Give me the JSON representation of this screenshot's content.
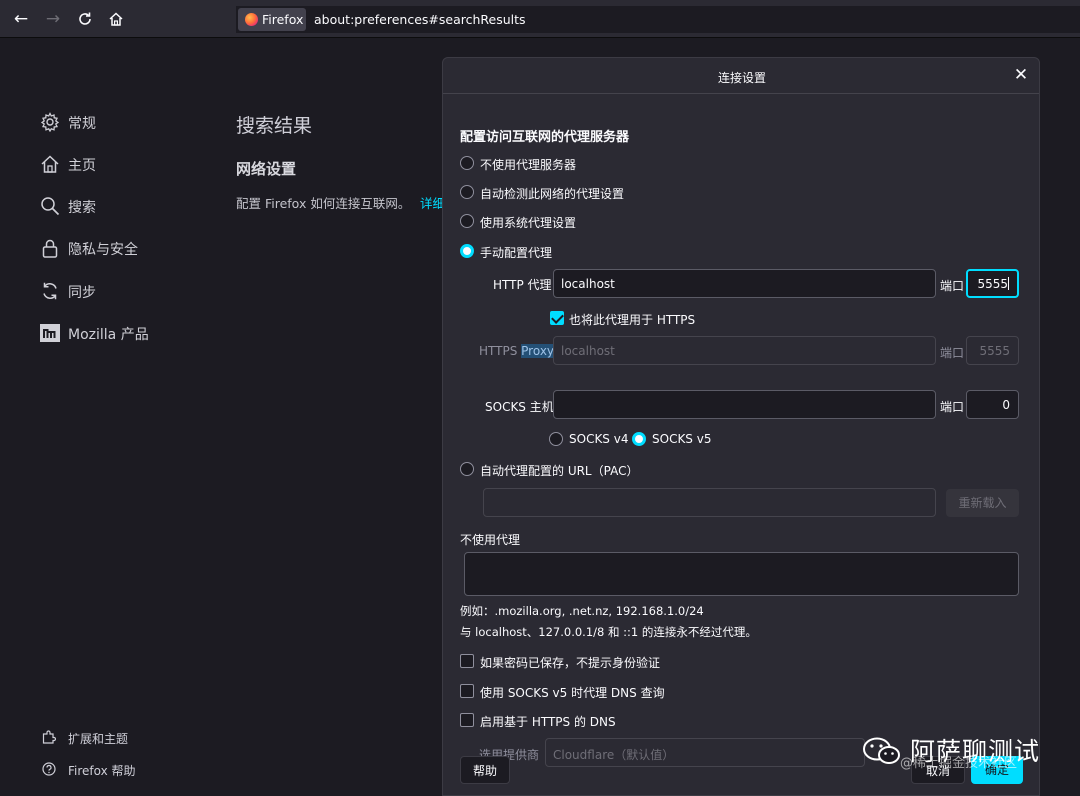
{
  "browser": {
    "identity_label": "Firefox",
    "url": "about:preferences#searchResults"
  },
  "sidebar": {
    "items": [
      {
        "label": "常规",
        "icon": "gear-icon"
      },
      {
        "label": "主页",
        "icon": "home-icon"
      },
      {
        "label": "搜索",
        "icon": "search-icon"
      },
      {
        "label": "隐私与安全",
        "icon": "lock-icon"
      },
      {
        "label": "同步",
        "icon": "sync-icon"
      },
      {
        "label": "Mozilla 产品",
        "icon": "mozilla-icon"
      }
    ],
    "bottom": [
      {
        "label": "扩展和主题",
        "icon": "puzzle-icon"
      },
      {
        "label": "Firefox 帮助",
        "icon": "help-icon"
      }
    ]
  },
  "content": {
    "title": "搜索结果",
    "section": "网络设置",
    "description": "配置 Firefox 如何连接互联网。",
    "link_partial": "详细"
  },
  "dialog": {
    "title": "连接设置",
    "heading": "配置访问互联网的代理服务器",
    "options": {
      "no_proxy": "不使用代理服务器",
      "auto_detect": "自动检测此网络的代理设置",
      "system": "使用系统代理设置",
      "manual": "手动配置代理",
      "pac": "自动代理配置的 URL（PAC）"
    },
    "selected_option": "manual",
    "http_label": "HTTP 代理",
    "http_value": "localhost",
    "port_label": "端口",
    "http_port": "5555",
    "also_https_label": "也将此代理用于 HTTPS",
    "also_https_checked": true,
    "https_label_prefix": "HTTPS",
    "https_label_suffix": "Proxy",
    "https_value": "localhost",
    "https_port": "5555",
    "socks_label": "SOCKS 主机",
    "socks_value": "",
    "socks_port": "0",
    "socks_v4": "SOCKS v4",
    "socks_v5": "SOCKS v5",
    "socks_selected": "v5",
    "reload_button": "重新载入",
    "no_proxy_for_label": "不使用代理",
    "no_proxy_for_value": "",
    "example_line": "例如：.mozilla.org, .net.nz, 192.168.1.0/24",
    "localhost_note": "与 localhost、127.0.0.1/8 和 ::1 的连接永不经过代理。",
    "checkboxes": {
      "no_auth_prompt": "如果密码已保存，不提示身份验证",
      "socks_dns": "使用 SOCKS v5 时代理 DNS 查询",
      "https_dns": "启用基于 HTTPS 的 DNS"
    },
    "provider_label": "选用提供商",
    "provider_value": "Cloudflare（默认值）",
    "help_button": "帮助",
    "cancel_button": "取消",
    "ok_button": "确定"
  },
  "watermark": {
    "title": "阿萨聊测试",
    "subtitle": "@稀土掘金技术社区"
  },
  "colors": {
    "accent": "#00ddff",
    "background": "#1c1b22",
    "panel": "#2b2a33"
  }
}
